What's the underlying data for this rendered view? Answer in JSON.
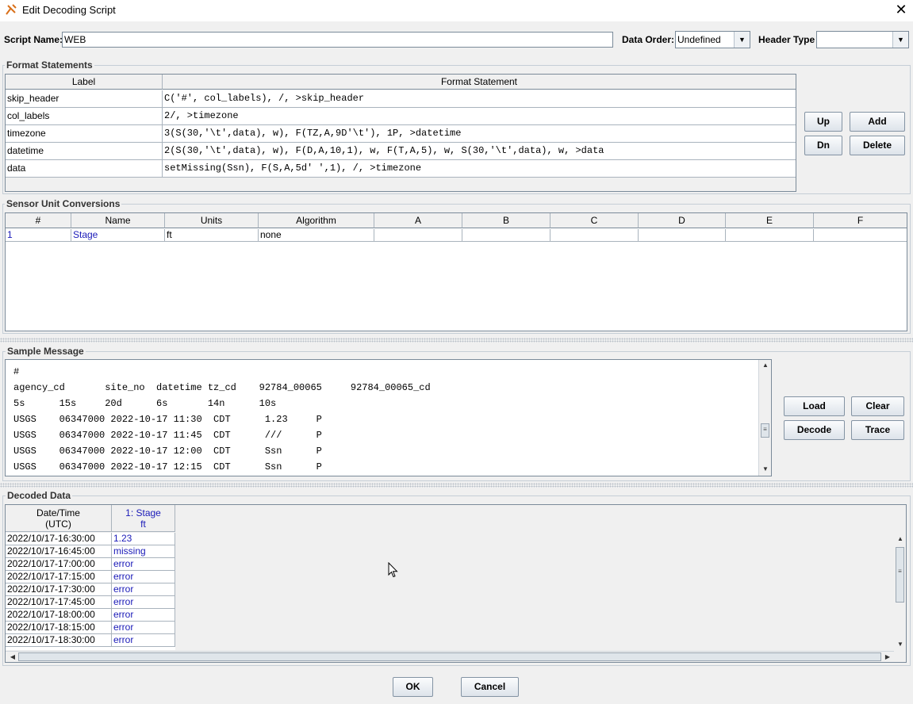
{
  "window": {
    "title": "Edit Decoding Script",
    "close": "✕"
  },
  "header": {
    "script_name_label": "Script Name:",
    "script_name_value": "WEB",
    "data_order_label": "Data Order:",
    "data_order_value": "Undefined",
    "header_type_label": "Header Type",
    "header_type_value": ""
  },
  "format_statements": {
    "title": "Format Statements",
    "columns": [
      "Label",
      "Format Statement"
    ],
    "rows": [
      {
        "label": "skip_header",
        "statement": "C('#', col_labels), /, >skip_header"
      },
      {
        "label": "col_labels",
        "statement": "2/, >timezone"
      },
      {
        "label": "timezone",
        "statement": "3(S(30,'\\t',data), w), F(TZ,A,9D'\\t'), 1P, >datetime"
      },
      {
        "label": "datetime",
        "statement": "2(S(30,'\\t',data), w), F(D,A,10,1), w, F(T,A,5), w, S(30,'\\t',data), w, >data"
      },
      {
        "label": "data",
        "statement": "setMissing(Ssn), F(S,A,5d' ',1), /, >timezone"
      }
    ],
    "buttons": {
      "up": "Up",
      "add": "Add",
      "dn": "Dn",
      "delete": "Delete"
    }
  },
  "sensor_units": {
    "title": "Sensor Unit Conversions",
    "columns": [
      "#",
      "Name",
      "Units",
      "Algorithm",
      "A",
      "B",
      "C",
      "D",
      "E",
      "F"
    ],
    "rows": [
      {
        "num": "1",
        "name": "Stage",
        "units": "ft",
        "algorithm": "none"
      }
    ]
  },
  "sample_message": {
    "title": "Sample Message",
    "lines": [
      "#",
      "agency_cd       site_no  datetime tz_cd    92784_00065     92784_00065_cd",
      "5s      15s     20d      6s       14n      10s",
      "USGS    06347000 2022-10-17 11:30  CDT      1.23     P",
      "USGS    06347000 2022-10-17 11:45  CDT      ///      P",
      "USGS    06347000 2022-10-17 12:00  CDT      Ssn      P",
      "USGS    06347000 2022-10-17 12:15  CDT      Ssn      P"
    ],
    "buttons": {
      "load": "Load",
      "clear": "Clear",
      "decode": "Decode",
      "trace": "Trace"
    }
  },
  "decoded_data": {
    "title": "Decoded Data",
    "col_datetime": [
      "Date/Time",
      "(UTC)"
    ],
    "col_sensor": [
      "1: Stage",
      "ft"
    ],
    "rows": [
      {
        "time": "2022/10/17-16:30:00",
        "value": "1.23"
      },
      {
        "time": "2022/10/17-16:45:00",
        "value": "missing"
      },
      {
        "time": "2022/10/17-17:00:00",
        "value": "error"
      },
      {
        "time": "2022/10/17-17:15:00",
        "value": "error"
      },
      {
        "time": "2022/10/17-17:30:00",
        "value": "error"
      },
      {
        "time": "2022/10/17-17:45:00",
        "value": "error"
      },
      {
        "time": "2022/10/17-18:00:00",
        "value": "error"
      },
      {
        "time": "2022/10/17-18:15:00",
        "value": "error"
      },
      {
        "time": "2022/10/17-18:30:00",
        "value": "error"
      }
    ]
  },
  "footer": {
    "ok": "OK",
    "cancel": "Cancel"
  }
}
